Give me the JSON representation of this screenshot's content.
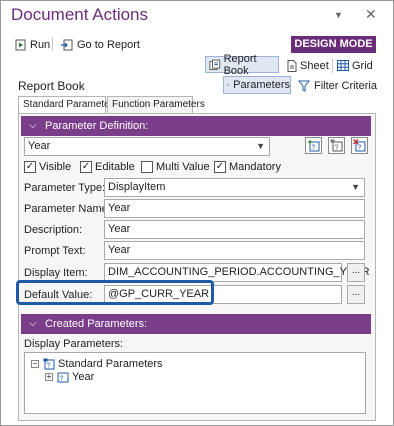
{
  "pane": {
    "title": "Document Actions",
    "dropdown_icon": "dropdown-arrow-icon",
    "close_icon": "close-icon"
  },
  "toolbar": {
    "run_label": "Run",
    "goto_report_label": "Go to Report",
    "mode_badge": "DESIGN MODE",
    "report_book_label": "Report Book",
    "sheet_label": "Sheet",
    "grid_label": "Grid"
  },
  "report_book": {
    "heading": "Report Book",
    "parameters_label": "Parameters",
    "filter_criteria_label": "Filter Criteria",
    "tabs": [
      {
        "label": "Standard Parameters",
        "active": true
      },
      {
        "label": "Function Parameters",
        "active": false
      }
    ]
  },
  "parameter_definition": {
    "header": "Parameter Definition:",
    "selected_parameter": "Year",
    "checkboxes": [
      {
        "label": "Visible",
        "checked": true
      },
      {
        "label": "Editable",
        "checked": true
      },
      {
        "label": "Multi Value",
        "checked": false
      },
      {
        "label": "Mandatory",
        "checked": true
      }
    ],
    "fields": {
      "type_label": "Parameter Type:",
      "type_value": "DisplayItem",
      "name_label": "Parameter Name:",
      "name_value": "Year",
      "description_label": "Description:",
      "description_value": "Year",
      "prompt_label": "Prompt Text:",
      "prompt_value": "Year",
      "display_item_label": "Display Item:",
      "display_item_value": "DIM_ACCOUNTING_PERIOD.ACCOUNTING_YEAR",
      "default_label": "Default Value:",
      "default_value": "@GP_CURR_YEAR"
    },
    "ellipsis": "..."
  },
  "created_parameters": {
    "header": "Created Parameters:",
    "display_label": "Display Parameters:",
    "tree": {
      "root": "Standard Parameters",
      "child": "Year"
    }
  },
  "colors": {
    "accent": "#6b2d7a",
    "section_header": "#7a3d8a",
    "highlight": "#1f5aa6"
  }
}
